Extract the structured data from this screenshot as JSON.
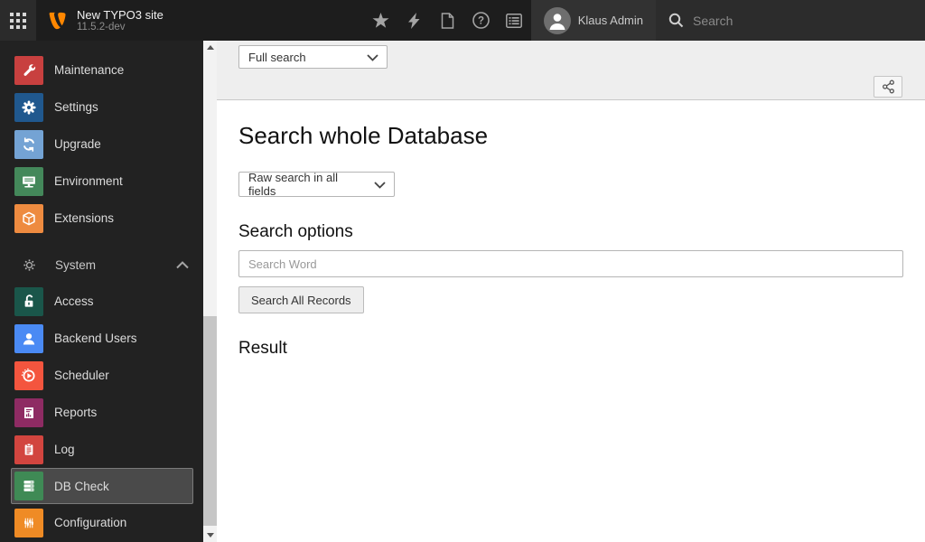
{
  "topbar": {
    "site_name": "New TYPO3 site",
    "version": "11.5.2-dev",
    "user_name": "Klaus Admin",
    "search_placeholder": "Search",
    "brand_color": "#ff8700",
    "toolbar_icons": [
      "star-icon",
      "bolt-icon",
      "document-icon",
      "help-icon",
      "list-icon"
    ]
  },
  "sidebar": {
    "groups": [
      {
        "items": [
          {
            "label": "Maintenance",
            "color": "#c8403f",
            "icon": "wrench-icon"
          },
          {
            "label": "Settings",
            "color": "#20588e",
            "icon": "gear-icon"
          },
          {
            "label": "Upgrade",
            "color": "#74a3d4",
            "icon": "refresh-icon"
          },
          {
            "label": "Environment",
            "color": "#44885a",
            "icon": "desktop-icon"
          },
          {
            "label": "Extensions",
            "color": "#ee8b40",
            "icon": "cube-icon"
          }
        ]
      },
      {
        "header": "System",
        "items": [
          {
            "label": "Access",
            "color": "#1a564a",
            "icon": "unlock-icon"
          },
          {
            "label": "Backend Users",
            "color": "#4a8af4",
            "icon": "user-icon"
          },
          {
            "label": "Scheduler",
            "color": "#f4553e",
            "icon": "play-circle-icon"
          },
          {
            "label": "Reports",
            "color": "#8e2b63",
            "icon": "report-chart-icon"
          },
          {
            "label": "Log",
            "color": "#d2453f",
            "icon": "clipboard-icon"
          },
          {
            "label": "DB Check",
            "color": "#3f8a55",
            "icon": "database-icon",
            "selected": true
          },
          {
            "label": "Configuration",
            "color": "#ef8b25",
            "icon": "sliders-icon"
          }
        ]
      }
    ]
  },
  "docheader": {
    "function_menu_value": "Full search"
  },
  "main": {
    "title": "Search whole Database",
    "mode_select_value": "Raw search in all fields",
    "options_heading": "Search options",
    "search_word_placeholder": "Search Word",
    "search_button_label": "Search All Records",
    "result_heading": "Result"
  }
}
